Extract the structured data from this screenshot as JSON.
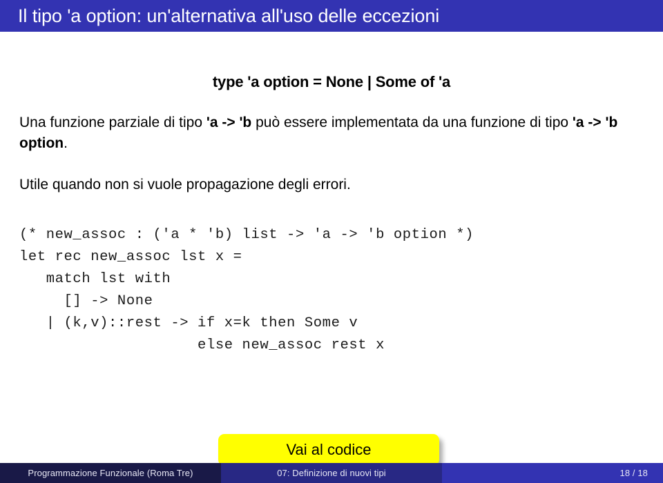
{
  "slide": {
    "title": "Il tipo 'a option: un'alternativa all'uso delle eccezioni",
    "block_heading": "type 'a option = None | Some of 'a",
    "paragraph_one": {
      "part1": "Una funzione parziale di tipo ",
      "bold1": "'a -> 'b",
      "part2": " può essere implementata da una funzione di tipo ",
      "bold2": "'a -> 'b option",
      "part3": "."
    },
    "paragraph_two": {
      "text": "Utile quando non si vuole propagazione degli errori."
    },
    "code": "(* new_assoc : ('a * 'b) list -> 'a -> 'b option *)\nlet rec new_assoc lst x =\n   match lst with\n     [] -> None\n   | (k,v)::rest -> if x=k then Some v\n                    else new_assoc rest x",
    "button": {
      "label": "Vai al codice"
    }
  },
  "footer": {
    "author": "Programmazione Funzionale  (Roma Tre)",
    "section": "07: Definizione di nuovi tipi",
    "page": "18 / 18"
  },
  "colors": {
    "title_bar": "#3333b2",
    "footer_dark": "#191947",
    "footer_mid": "#282884",
    "footer_light": "#3333b2",
    "button_fill": "#ffff00",
    "text": "#000000"
  }
}
